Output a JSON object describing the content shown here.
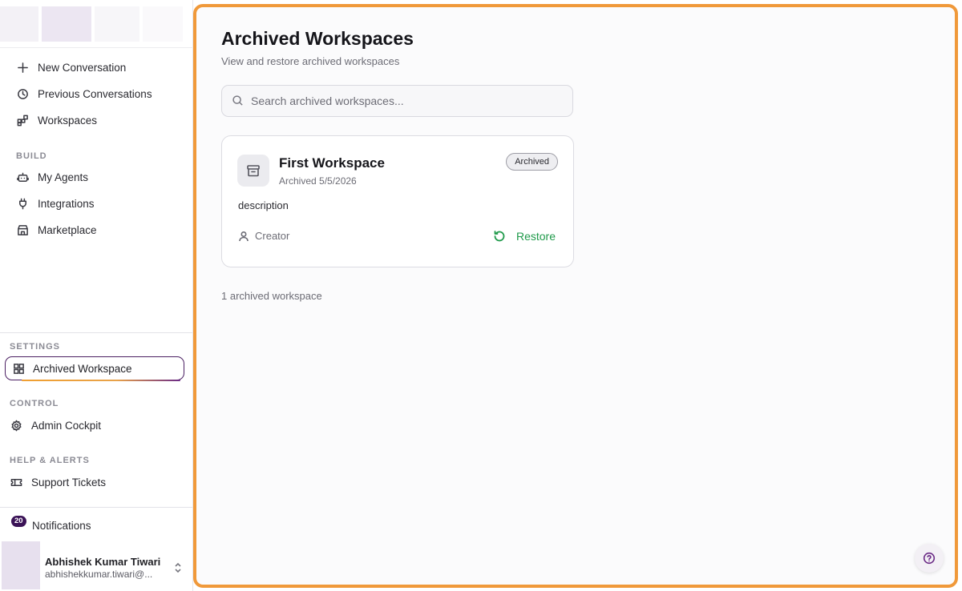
{
  "sidebar": {
    "primary": [
      {
        "label": "New Conversation",
        "icon": "plus-icon"
      },
      {
        "label": "Previous Conversations",
        "icon": "clock-icon"
      },
      {
        "label": "Workspaces",
        "icon": "workspaces-icon"
      }
    ],
    "build_label": "BUILD",
    "build": [
      {
        "label": "My Agents",
        "icon": "robot-icon"
      },
      {
        "label": "Integrations",
        "icon": "plug-icon"
      },
      {
        "label": "Marketplace",
        "icon": "store-icon"
      }
    ],
    "settings_label": "SETTINGS",
    "settings": [
      {
        "label": "Archived Workspace",
        "icon": "grid-icon"
      }
    ],
    "control_label": "CONTROL",
    "control": [
      {
        "label": "Admin Cockpit",
        "icon": "gear-icon"
      }
    ],
    "help_label": "HELP & ALERTS",
    "help": [
      {
        "label": "Support Tickets",
        "icon": "ticket-icon"
      }
    ],
    "notifications": {
      "label": "Notifications",
      "count": "20"
    },
    "user": {
      "name": "Abhishek Kumar Tiwari",
      "email": "abhishekkumar.tiwari@..."
    }
  },
  "main": {
    "title": "Archived Workspaces",
    "subtitle": "View and restore archived workspaces",
    "search_placeholder": "Search archived workspaces...",
    "cards": [
      {
        "title": "First Workspace",
        "date": "Archived 5/5/2026",
        "badge": "Archived",
        "description": "description",
        "creator": "Creator",
        "action": "Restore"
      }
    ],
    "count_text": "1 archived workspace"
  },
  "colors": {
    "accent": "#f0993a",
    "active_border": "#4a1f62",
    "restore": "#1f9a4a",
    "badge_bg": "#3b1357"
  }
}
